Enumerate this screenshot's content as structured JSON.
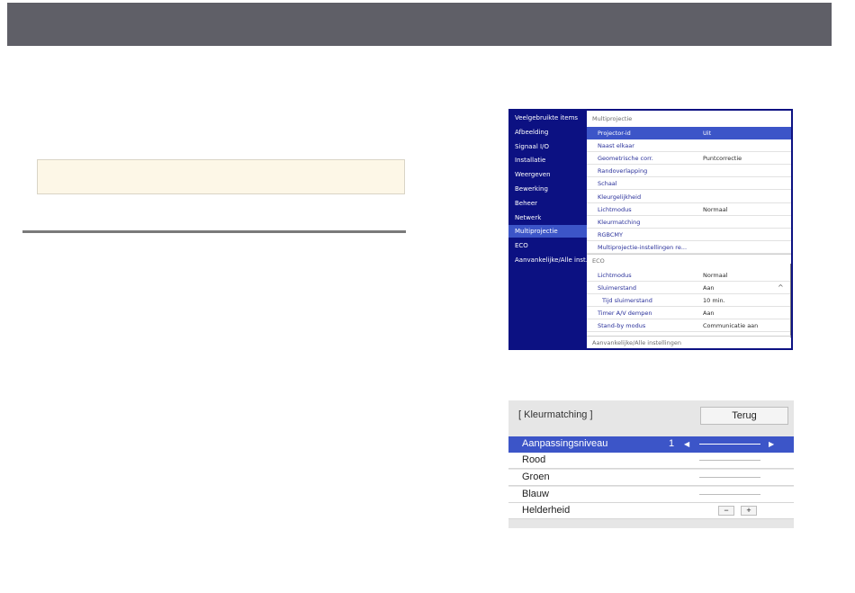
{
  "projector_menu": {
    "sidebar": [
      {
        "label": "Veelgebruikte items",
        "active": false
      },
      {
        "label": "Afbeelding",
        "active": false
      },
      {
        "label": "Signaal I/O",
        "active": false
      },
      {
        "label": "Installatie",
        "active": false
      },
      {
        "label": "Weergeven",
        "active": false
      },
      {
        "label": "Bewerking",
        "active": false
      },
      {
        "label": "Beheer",
        "active": false
      },
      {
        "label": "Netwerk",
        "active": false
      },
      {
        "label": "Multiprojectie",
        "active": true
      },
      {
        "label": "ECO",
        "active": false
      },
      {
        "label": "Aanvankelijke/Alle inst...",
        "active": false
      }
    ],
    "sections": {
      "multiprojectie": "Multiprojectie",
      "eco": "ECO",
      "all_settings": "Aanvankelijke/Alle instellingen"
    },
    "multiprojectie_rows": [
      {
        "label": "Projector-id",
        "value": "Uit",
        "selected": true
      },
      {
        "label": "Naast elkaar",
        "value": ""
      },
      {
        "label": "Geometrische corr.",
        "value": "Puntcorrectie"
      },
      {
        "label": "Randoverlapping",
        "value": ""
      },
      {
        "label": "Schaal",
        "value": ""
      },
      {
        "label": "Kleurgelijkheid",
        "value": ""
      },
      {
        "label": "Lichtmodus",
        "value": "Normaal"
      },
      {
        "label": "Kleurmatching",
        "value": ""
      },
      {
        "label": "RGBCMY",
        "value": ""
      },
      {
        "label": "Multiprojectie-instellingen re...",
        "value": ""
      }
    ],
    "eco_rows": [
      {
        "label": "Lichtmodus",
        "value": "Normaal"
      },
      {
        "label": "Sluimerstand",
        "value": "Aan"
      },
      {
        "label": "Tijd sluimerstand",
        "value": "10 min."
      },
      {
        "label": "Timer A/V dempen",
        "value": "Aan"
      },
      {
        "label": "Stand-by modus",
        "value": "Communicatie aan"
      }
    ],
    "caret": "^"
  },
  "color_dialog": {
    "title": "[ Kleurmatching ]",
    "back_label": "Terug",
    "rows": {
      "level_label": "Aanpassingsniveau",
      "level_value": "1",
      "red": "Rood",
      "green": "Groen",
      "blue": "Blauw",
      "brightness": "Helderheid"
    },
    "minus": "−",
    "plus": "+",
    "arrow_left": "◀",
    "arrow_right": "▶"
  },
  "colors": {
    "menu_bg": "#0c1182",
    "highlight": "#3c55c8",
    "top_bar": "#5f5f67",
    "note_bg": "#fdf7e7"
  }
}
